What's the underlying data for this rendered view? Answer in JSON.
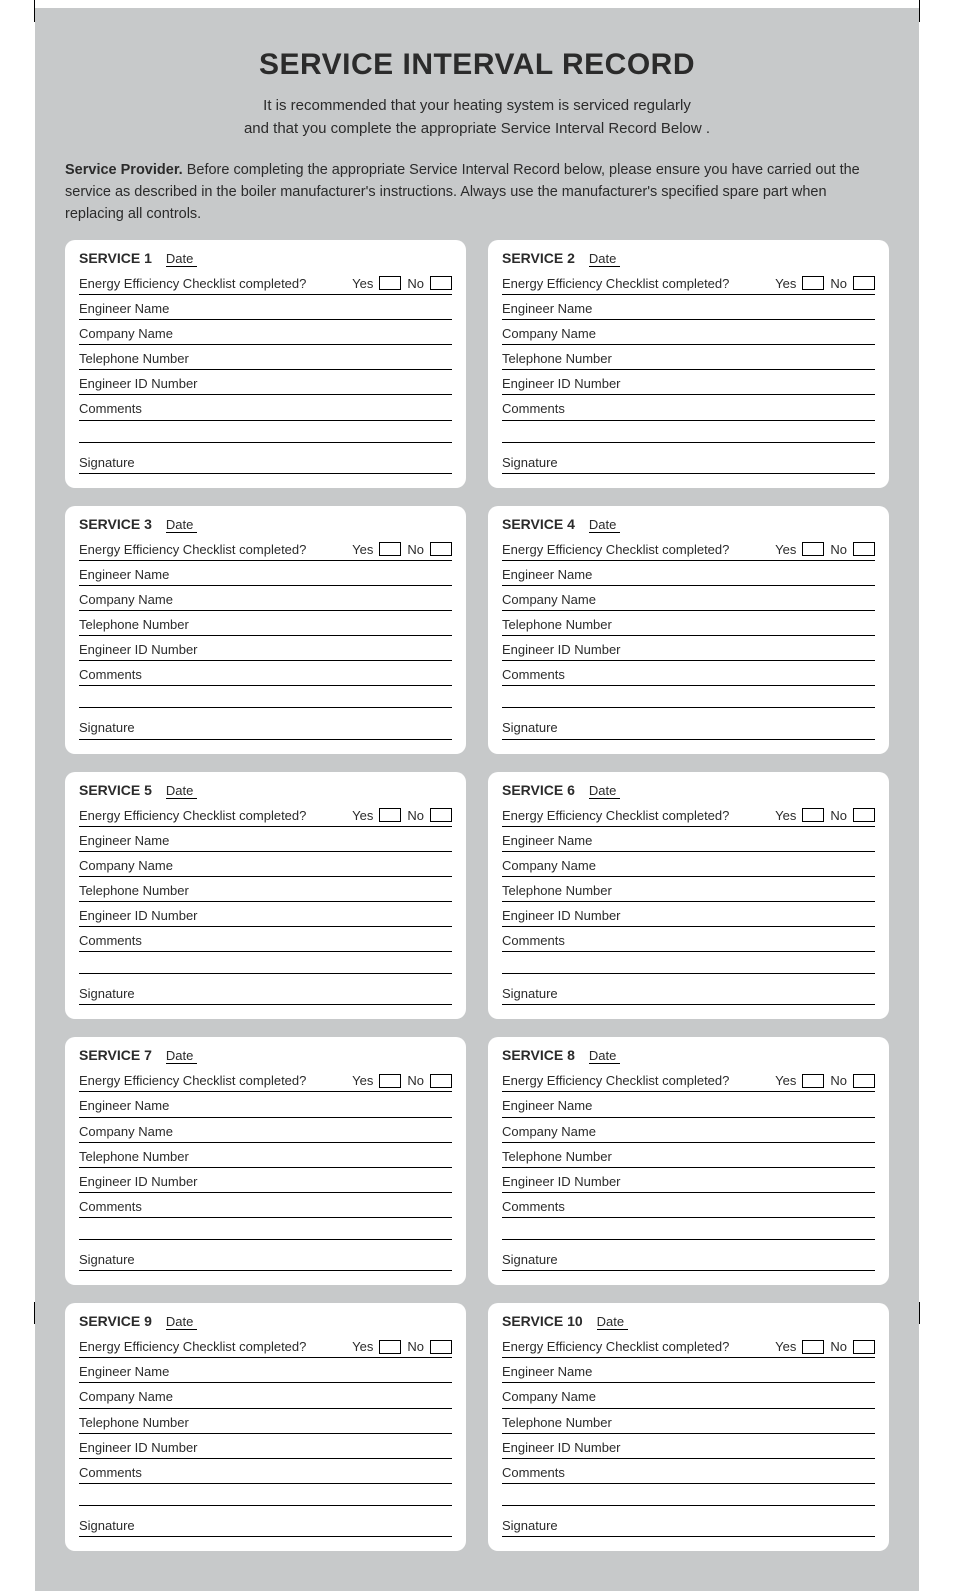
{
  "title": "SERVICE INTERVAL RECORD",
  "intro_line1": "It is recommended that your heating system is serviced regularly",
  "intro_line2": "and that you complete the appropriate Service Interval Record Below .",
  "provider_lead": "Service Provider.",
  "provider_text": " Before completing the appropriate Service Interval Record below, please ensure you have carried out the service as described in the boiler manufacturer's instructions. Always use the manufacturer's specified spare part when replacing all controls.",
  "labels": {
    "date": "Date",
    "checklist_q": "Energy Efficiency Checklist completed?",
    "yes": "Yes",
    "no": "No",
    "engineer_name": "Engineer Name",
    "company_name": "Company Name",
    "telephone": "Telephone Number",
    "engineer_id": "Engineer ID Number",
    "comments": "Comments",
    "signature": "Signature"
  },
  "services": [
    {
      "heading": "SERVICE 1"
    },
    {
      "heading": "SERVICE 2"
    },
    {
      "heading": "SERVICE 3"
    },
    {
      "heading": "SERVICE 4"
    },
    {
      "heading": "SERVICE 5"
    },
    {
      "heading": "SERVICE 6"
    },
    {
      "heading": "SERVICE 7"
    },
    {
      "heading": "SERVICE 8"
    },
    {
      "heading": "SERVICE 9"
    },
    {
      "heading": "SERVICE 10"
    }
  ]
}
